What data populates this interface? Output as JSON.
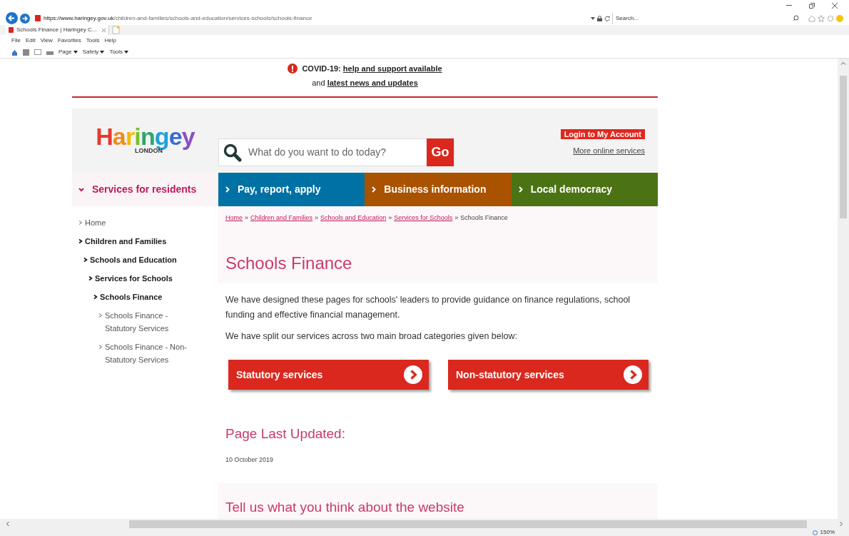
{
  "browser": {
    "url_host": "https://www.haringey.gov.uk",
    "url_path": "/children-and-families/schools-and-education/services-schools/schools-finance",
    "search_placeholder": "Search...",
    "tab_title": "Schools Finance | Haringey C...",
    "menu": [
      "File",
      "Edit",
      "View",
      "Favorites",
      "Tools",
      "Help"
    ],
    "command_menus": [
      "Page",
      "Safety",
      "Tools"
    ],
    "zoom": "150%"
  },
  "covid": {
    "label": "COVID-19:",
    "link": "help and support available",
    "joiner": "and",
    "link_2": "latest news and updates"
  },
  "header": {
    "logo": "Haringey",
    "logo_sub": "LONDON",
    "search_placeholder": "What do you want to do today?",
    "go": "Go",
    "login": "Login to My Account",
    "more": "More online services"
  },
  "nav": {
    "residents": "Services for residents",
    "tabs": [
      {
        "label": "Pay, report, apply",
        "color": "#0071a4"
      },
      {
        "label": "Business information",
        "color": "#a95200"
      },
      {
        "label": "Local democracy",
        "color": "#4b7314"
      }
    ]
  },
  "sidebar": {
    "items": [
      {
        "label": "Home",
        "selected": false
      },
      {
        "label": "Children and Families",
        "selected": true,
        "children": [
          {
            "label": "Schools and Education",
            "selected": true,
            "children": [
              {
                "label": "Services for Schools",
                "selected": true,
                "children": [
                  {
                    "label": "Schools Finance",
                    "selected": true,
                    "children": [
                      {
                        "label": "Schools Finance - Statutory Services",
                        "selected": false
                      },
                      {
                        "label": "Schools Finance - Non-Statutory Services",
                        "selected": false
                      }
                    ]
                  }
                ]
              }
            ]
          }
        ]
      }
    ]
  },
  "breadcrumb": {
    "separator": "»",
    "links": [
      "Home",
      "Children and Families",
      "Schools and Education",
      "Services for Schools"
    ],
    "current": "Schools Finance"
  },
  "title": "Schools Finance",
  "paragraphs": [
    "We have designed these pages for schools' leaders to provide guidance on finance regulations, school funding and effective financial management.",
    "We have split our services across two main broad categories given below:"
  ],
  "buttons": [
    "Statutory services",
    "Non-statutory services"
  ],
  "updated": {
    "heading": "Page Last Updated:",
    "date": "10 October 2019"
  },
  "feedback": {
    "heading": "Tell us what you think about the website"
  }
}
